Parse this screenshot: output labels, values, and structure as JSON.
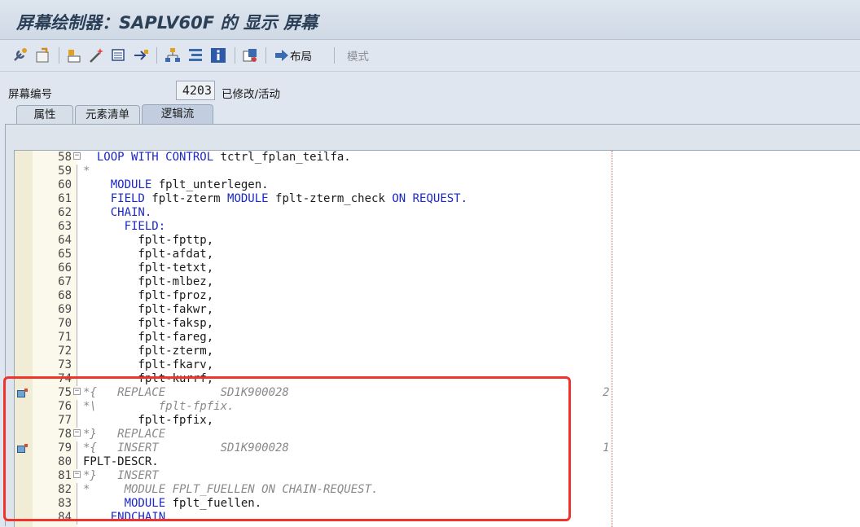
{
  "window": {
    "title": "屏幕绘制器：SAPLV60F 的 显示 屏幕"
  },
  "toolbar": {
    "icons": [
      "wrench-icon",
      "switch-icon",
      "object-list-icon",
      "magic-wand-icon",
      "display-object-icon",
      "move-icon",
      "hierarchy-icon",
      "structure-icon",
      "info-icon",
      "other-object-icon"
    ],
    "layout_label": "布局",
    "mode_label": "模式"
  },
  "screen": {
    "label": "屏幕编号",
    "number": "4203",
    "status": "已修改/活动"
  },
  "tabs": [
    {
      "label": "属性",
      "active": false
    },
    {
      "label": "元素清单",
      "active": false
    },
    {
      "label": "逻辑流",
      "active": true
    }
  ],
  "editor": {
    "lines": [
      {
        "num": "58",
        "fold": "minus",
        "parts": [
          {
            "t": "  LOOP WITH CONTROL",
            "c": "kw"
          },
          {
            "t": " tctrl_fplan_teilfa.",
            "c": ""
          }
        ]
      },
      {
        "num": "59",
        "fold": "",
        "parts": [
          {
            "t": "*",
            "c": "cm"
          }
        ]
      },
      {
        "num": "60",
        "fold": "",
        "parts": [
          {
            "t": "    MODULE",
            "c": "kw"
          },
          {
            "t": " fplt_unterlegen.",
            "c": ""
          }
        ]
      },
      {
        "num": "61",
        "fold": "",
        "parts": [
          {
            "t": "    FIELD",
            "c": "kw"
          },
          {
            "t": " fplt-zterm ",
            "c": ""
          },
          {
            "t": "MODULE",
            "c": "kw"
          },
          {
            "t": " fplt-zterm_check ",
            "c": ""
          },
          {
            "t": "ON REQUEST.",
            "c": "kw"
          }
        ]
      },
      {
        "num": "62",
        "fold": "",
        "parts": [
          {
            "t": "    CHAIN.",
            "c": "kw"
          }
        ]
      },
      {
        "num": "63",
        "fold": "",
        "parts": [
          {
            "t": "      FIELD:",
            "c": "kw"
          }
        ]
      },
      {
        "num": "64",
        "fold": "",
        "parts": [
          {
            "t": "        fplt-fpttp,",
            "c": ""
          }
        ]
      },
      {
        "num": "65",
        "fold": "",
        "parts": [
          {
            "t": "        fplt-afdat,",
            "c": ""
          }
        ]
      },
      {
        "num": "66",
        "fold": "",
        "parts": [
          {
            "t": "        fplt-tetxt,",
            "c": ""
          }
        ]
      },
      {
        "num": "67",
        "fold": "",
        "parts": [
          {
            "t": "        fplt-mlbez,",
            "c": ""
          }
        ]
      },
      {
        "num": "68",
        "fold": "",
        "parts": [
          {
            "t": "        fplt-fproz,",
            "c": ""
          }
        ]
      },
      {
        "num": "69",
        "fold": "",
        "parts": [
          {
            "t": "        fplt-fakwr,",
            "c": ""
          }
        ]
      },
      {
        "num": "70",
        "fold": "",
        "parts": [
          {
            "t": "        fplt-faksp,",
            "c": ""
          }
        ]
      },
      {
        "num": "71",
        "fold": "",
        "parts": [
          {
            "t": "        fplt-fareg,",
            "c": ""
          }
        ]
      },
      {
        "num": "72",
        "fold": "",
        "parts": [
          {
            "t": "        fplt-zterm,",
            "c": ""
          }
        ]
      },
      {
        "num": "73",
        "fold": "",
        "parts": [
          {
            "t": "        fplt-fkarv,",
            "c": ""
          }
        ]
      },
      {
        "num": "74",
        "fold": "",
        "parts": [
          {
            "t": "        fplt-kurrf,",
            "c": ""
          }
        ]
      },
      {
        "num": "75",
        "fold": "minus",
        "bookmark": true,
        "parts": [
          {
            "t": "*{   REPLACE        SD1K900028",
            "c": "cm"
          }
        ],
        "right": "2"
      },
      {
        "num": "76",
        "fold": "",
        "parts": [
          {
            "t": "*\\         fplt-fpfix.",
            "c": "cm"
          }
        ]
      },
      {
        "num": "77",
        "fold": "",
        "parts": [
          {
            "t": "        fplt-fpfix,",
            "c": ""
          }
        ]
      },
      {
        "num": "78",
        "fold": "minus",
        "parts": [
          {
            "t": "*}   REPLACE",
            "c": "cm"
          }
        ]
      },
      {
        "num": "79",
        "fold": "",
        "bookmark": true,
        "parts": [
          {
            "t": "*{   INSERT         SD1K900028",
            "c": "cm"
          }
        ],
        "right": "1"
      },
      {
        "num": "80",
        "fold": "",
        "parts": [
          {
            "t": "FPLT-DESCR.",
            "c": ""
          }
        ]
      },
      {
        "num": "81",
        "fold": "minus",
        "parts": [
          {
            "t": "*}   INSERT",
            "c": "cm"
          }
        ]
      },
      {
        "num": "82",
        "fold": "",
        "parts": [
          {
            "t": "*     MODULE FPLT_FUELLEN ON CHAIN-REQUEST.",
            "c": "cm"
          }
        ]
      },
      {
        "num": "83",
        "fold": "",
        "parts": [
          {
            "t": "      MODULE",
            "c": "kw"
          },
          {
            "t": " fplt_fuellen.",
            "c": ""
          }
        ]
      },
      {
        "num": "84",
        "fold": "",
        "parts": [
          {
            "t": "    ENDCHAIN.",
            "c": "kw"
          }
        ]
      }
    ]
  },
  "colors": {
    "keyword": "#1b28c8",
    "comment": "#8a8a8a",
    "highlight": "#f0342c"
  }
}
